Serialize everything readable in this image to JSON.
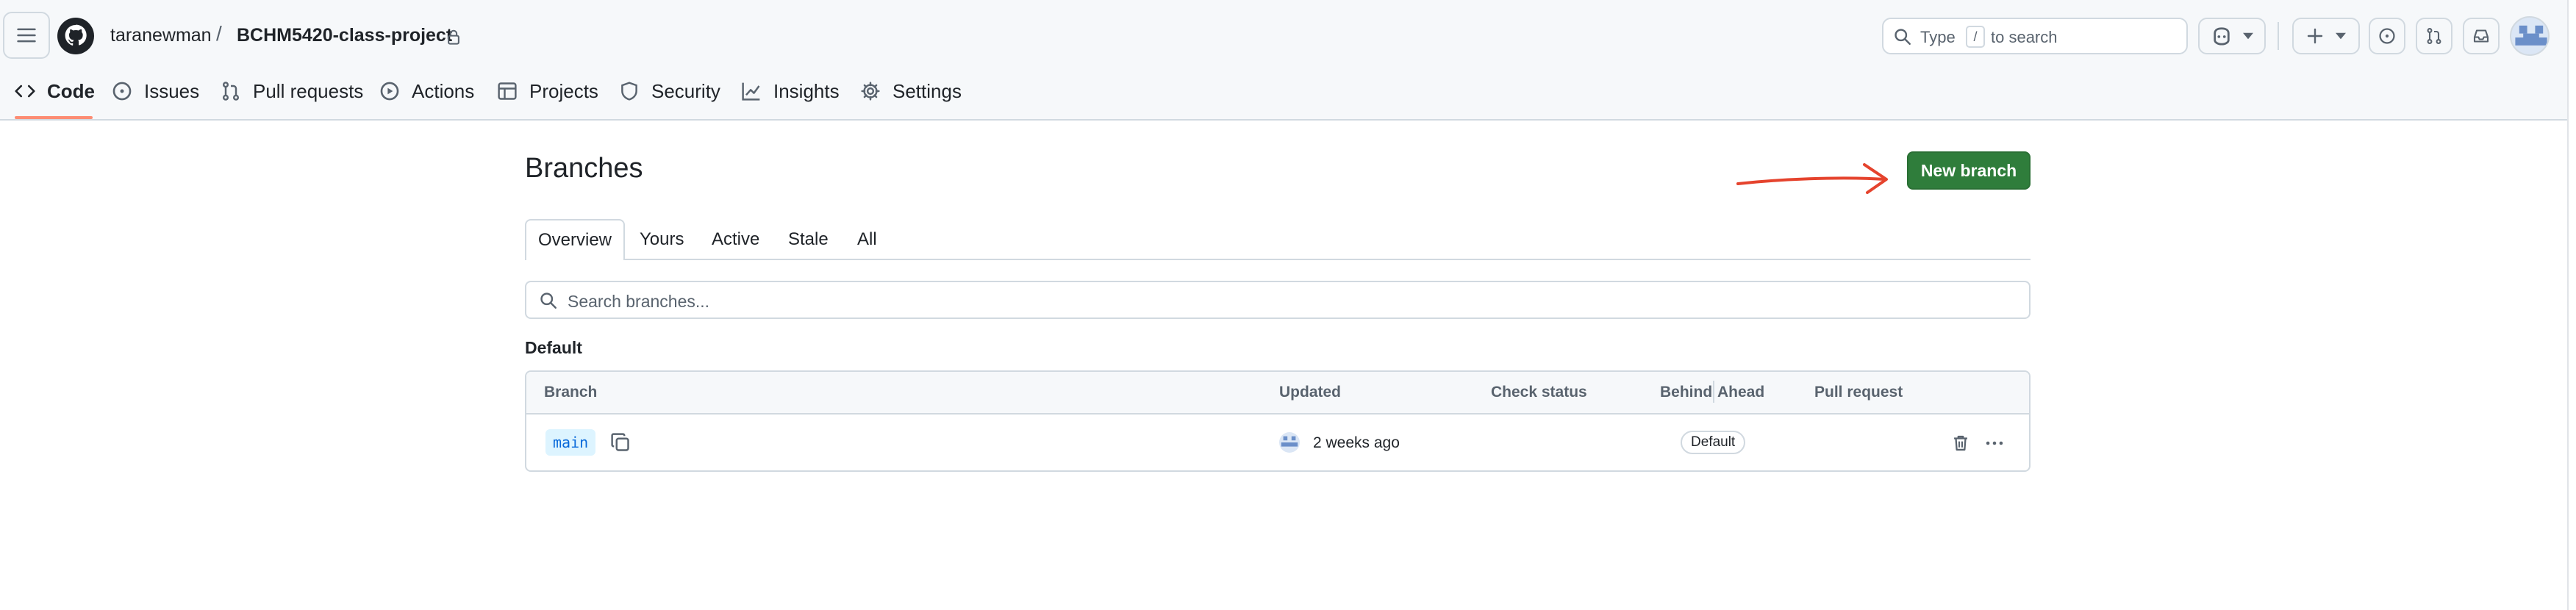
{
  "header": {
    "owner": "taranewman",
    "separator": "/",
    "repo": "BCHM5420-class-project",
    "search_prefix": "Type",
    "search_key": "/",
    "search_suffix": "to search"
  },
  "repo_nav": {
    "code": "Code",
    "issues": "Issues",
    "pull_requests": "Pull requests",
    "actions": "Actions",
    "projects": "Projects",
    "security": "Security",
    "insights": "Insights",
    "settings": "Settings"
  },
  "page": {
    "title": "Branches",
    "new_branch_label": "New branch",
    "tabs": [
      "Overview",
      "Yours",
      "Active",
      "Stale",
      "All"
    ],
    "search_placeholder": "Search branches...",
    "section_title": "Default"
  },
  "table": {
    "headers": {
      "branch": "Branch",
      "updated": "Updated",
      "check_status": "Check status",
      "behind": "Behind",
      "ahead": "Ahead",
      "pull_request": "Pull request"
    },
    "rows": [
      {
        "branch": "main",
        "updated": "2 weeks ago",
        "badge": "Default"
      }
    ]
  },
  "colors": {
    "primary_button": "#2f7d3b",
    "annotation_arrow": "#e5432d",
    "active_tab_underline": "#fd8c73",
    "branch_name_bg": "#ddf4ff",
    "branch_name_text": "#0969da"
  }
}
